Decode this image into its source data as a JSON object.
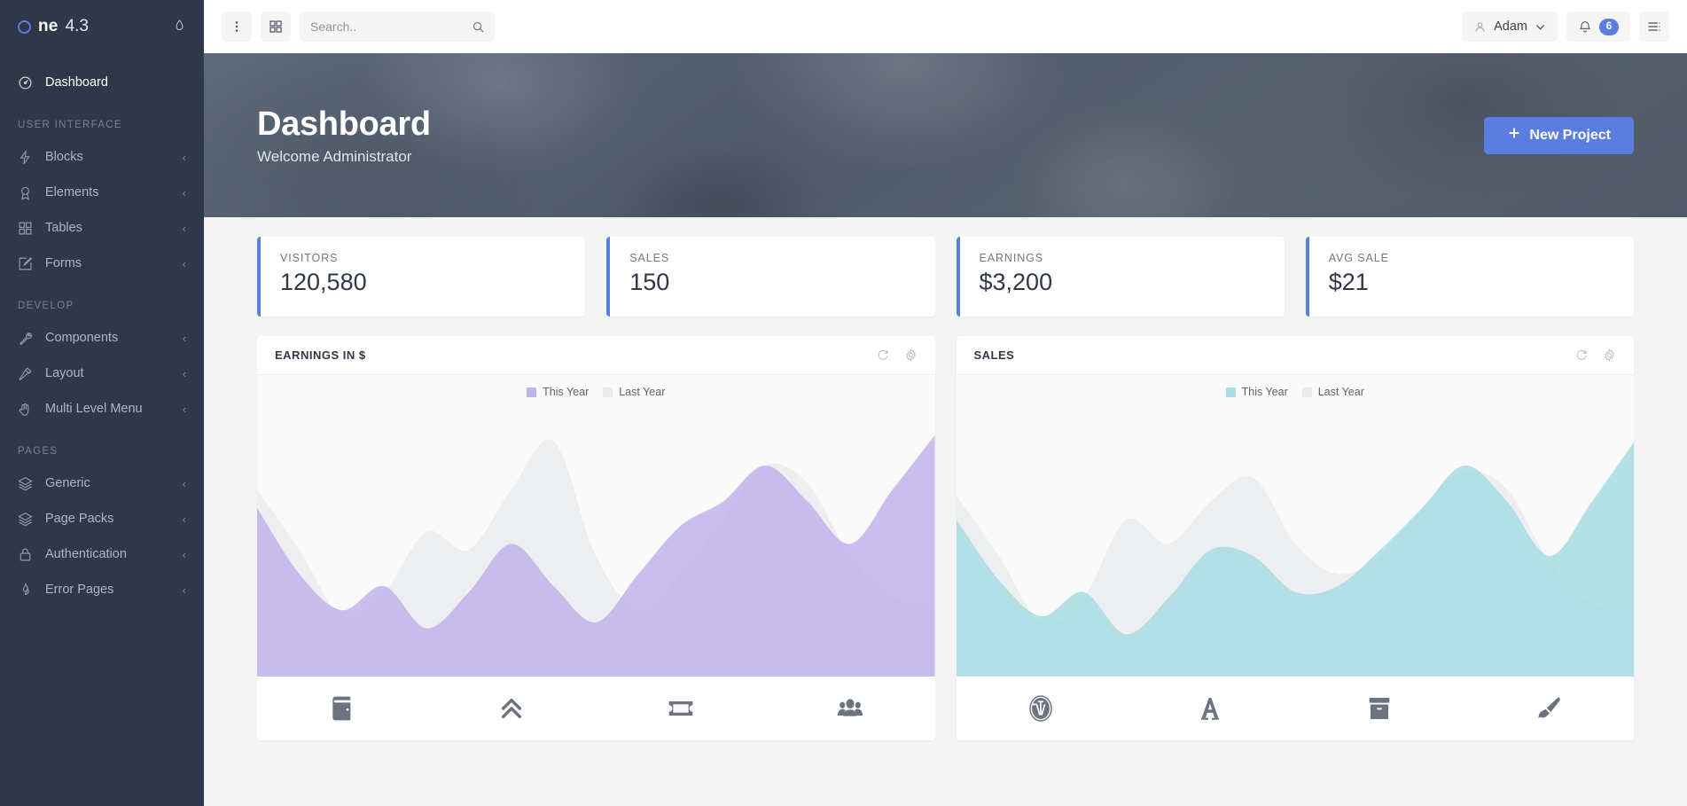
{
  "brand": {
    "ring_icon": "circle-icon",
    "name": "ne",
    "version": "4.3",
    "drop_icon": "droplet-icon"
  },
  "sidebar": {
    "top_item": {
      "label": "Dashboard",
      "icon": "dashboard-gauge-icon"
    },
    "sections": [
      {
        "title": "USER INTERFACE",
        "items": [
          {
            "label": "Blocks",
            "icon": "bolt-icon",
            "caret": "‹"
          },
          {
            "label": "Elements",
            "icon": "badge-icon",
            "caret": "‹"
          },
          {
            "label": "Tables",
            "icon": "grid-icon",
            "caret": "‹"
          },
          {
            "label": "Forms",
            "icon": "edit-square-icon",
            "caret": "‹"
          }
        ]
      },
      {
        "title": "DEVELOP",
        "items": [
          {
            "label": "Components",
            "icon": "wrench-icon",
            "caret": "‹"
          },
          {
            "label": "Layout",
            "icon": "magic-wand-icon",
            "caret": "‹"
          },
          {
            "label": "Multi Level Menu",
            "icon": "hand-icon",
            "caret": "‹"
          }
        ]
      },
      {
        "title": "PAGES",
        "items": [
          {
            "label": "Generic",
            "icon": "layers-icon",
            "caret": "‹"
          },
          {
            "label": "Page Packs",
            "icon": "layers-icon",
            "caret": "‹"
          },
          {
            "label": "Authentication",
            "icon": "lock-icon",
            "caret": "‹"
          },
          {
            "label": "Error Pages",
            "icon": "flame-icon",
            "caret": "‹"
          }
        ]
      }
    ]
  },
  "topbar": {
    "menu_icon": "vertical-dots-icon",
    "apps_icon": "grid-apps-icon",
    "search": {
      "placeholder": "Search..",
      "value": "",
      "icon": "search-icon"
    },
    "user": {
      "name": "Adam",
      "avatar_icon": "user-icon",
      "caret_icon": "chevron-down-icon"
    },
    "notifications": {
      "icon": "bell-icon",
      "count": "6"
    },
    "options_icon": "list-options-icon"
  },
  "hero": {
    "title": "Dashboard",
    "subtitle": "Welcome Administrator",
    "new_project": {
      "label": "New Project",
      "icon": "plus-icon"
    }
  },
  "stats": [
    {
      "title": "VISITORS",
      "value": "120,580"
    },
    {
      "title": "SALES",
      "value": "150"
    },
    {
      "title": "EARNINGS",
      "value": "$3,200"
    },
    {
      "title": "AVG SALE",
      "value": "$21"
    }
  ],
  "colors": {
    "accent": "#5a7ee0",
    "sidebar_bg": "#2f3848",
    "earnings_series": "#c3b5ec",
    "sales_series": "#a8dde2",
    "last_year_series": "#e8eaec"
  },
  "cards": [
    {
      "title": "EARNINGS IN $",
      "refresh_icon": "refresh-icon",
      "settings_icon": "gear-icon",
      "legend": [
        {
          "label": "This Year",
          "color": "#c3b5ec"
        },
        {
          "label": "Last Year",
          "color": "#e8eaec"
        }
      ],
      "footer_icons": [
        "book-icon",
        "chevron-double-up-icon",
        "ticket-icon",
        "users-group-icon"
      ]
    },
    {
      "title": "SALES",
      "refresh_icon": "refresh-icon",
      "settings_icon": "gear-icon",
      "legend": [
        {
          "label": "This Year",
          "color": "#a8dde2"
        },
        {
          "label": "Last Year",
          "color": "#e8eaec"
        }
      ],
      "footer_icons": [
        "wordpress-icon",
        "font-letter-a-icon",
        "archive-box-icon",
        "paint-brush-icon"
      ]
    }
  ],
  "chart_data": [
    {
      "type": "area",
      "title": "EARNINGS IN $",
      "xlabel": "",
      "ylabel": "",
      "grid": false,
      "legend_position": "top-center",
      "ylim": [
        0,
        100
      ],
      "x": [
        0,
        1,
        2,
        3,
        4,
        5,
        6,
        7,
        8,
        9,
        10,
        11,
        12,
        13,
        14,
        15,
        16
      ],
      "series": [
        {
          "name": "This Year",
          "color": "#c3b5ec",
          "values": [
            56,
            34,
            22,
            30,
            16,
            28,
            44,
            30,
            18,
            34,
            50,
            58,
            70,
            58,
            44,
            62,
            80
          ]
        },
        {
          "name": "Last Year",
          "color": "#e8eaec",
          "values": [
            62,
            42,
            20,
            28,
            48,
            42,
            62,
            78,
            40,
            22,
            34,
            52,
            70,
            64,
            40,
            26,
            24
          ]
        }
      ]
    },
    {
      "type": "area",
      "title": "SALES",
      "xlabel": "",
      "ylabel": "",
      "grid": false,
      "legend_position": "top-center",
      "ylim": [
        0,
        100
      ],
      "x": [
        0,
        1,
        2,
        3,
        4,
        5,
        6,
        7,
        8,
        9,
        10,
        11,
        12,
        13,
        14,
        15,
        16
      ],
      "series": [
        {
          "name": "This Year",
          "color": "#a8dde2",
          "values": [
            52,
            32,
            20,
            28,
            14,
            26,
            42,
            40,
            28,
            30,
            42,
            56,
            70,
            58,
            40,
            58,
            78
          ]
        },
        {
          "name": "Last Year",
          "color": "#e8eaec",
          "values": [
            60,
            40,
            18,
            26,
            52,
            44,
            58,
            66,
            44,
            34,
            40,
            56,
            68,
            62,
            38,
            24,
            22
          ]
        }
      ]
    }
  ]
}
